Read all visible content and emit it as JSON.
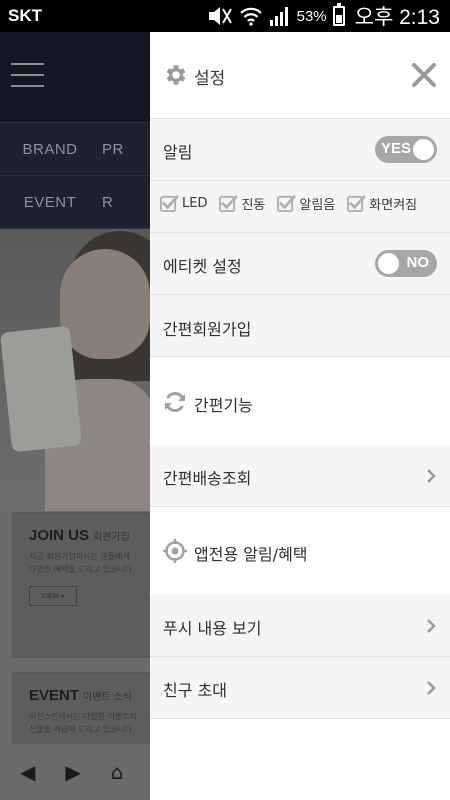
{
  "status_bar": {
    "carrier": "SKT",
    "battery": "53%",
    "time": "오후 2:13"
  },
  "background_app": {
    "nav_row1": [
      "BRAND",
      "PR"
    ],
    "nav_row2": [
      "EVENT",
      "R"
    ],
    "join_card": {
      "title": "JOIN US",
      "subtitle": "회원가입",
      "desc1": "지금 회원가입하시는 분들에게",
      "desc2": "다양한 혜택을 드리고 있습니다.",
      "button": "VIEW ▸"
    },
    "event_card": {
      "title": "EVENT",
      "subtitle": "이벤트 소식",
      "desc1": "미친스킨에서는 다양한 이벤트와",
      "desc2": "선물을 지급해 드리고 있습니다."
    }
  },
  "panel": {
    "title": "설정",
    "icons": {
      "settings": "gear-icon",
      "close": "close-icon",
      "refresh": "refresh-icon",
      "target": "target-icon"
    },
    "notification": {
      "label": "알림",
      "toggle": "YES",
      "on": true
    },
    "checks": [
      {
        "label": "LED",
        "checked": true
      },
      {
        "label": "진동",
        "checked": true
      },
      {
        "label": "알림음",
        "checked": true
      },
      {
        "label": "화면켜짐",
        "checked": true
      }
    ],
    "etiquette": {
      "label": "에티켓 설정",
      "toggle": "NO",
      "on": false
    },
    "signup": "간편회원가입",
    "quick_features": "간편기능",
    "delivery": "간편배송조회",
    "app_alerts": "앱전용 알림/혜택",
    "push_view": "푸시 내용 보기",
    "invite": "친구 초대"
  },
  "colors": {
    "toggle": "#a7a7a7",
    "check": "#b0b0b0",
    "icon": "#9a9a9a",
    "nav_bg": "#1d2130"
  }
}
